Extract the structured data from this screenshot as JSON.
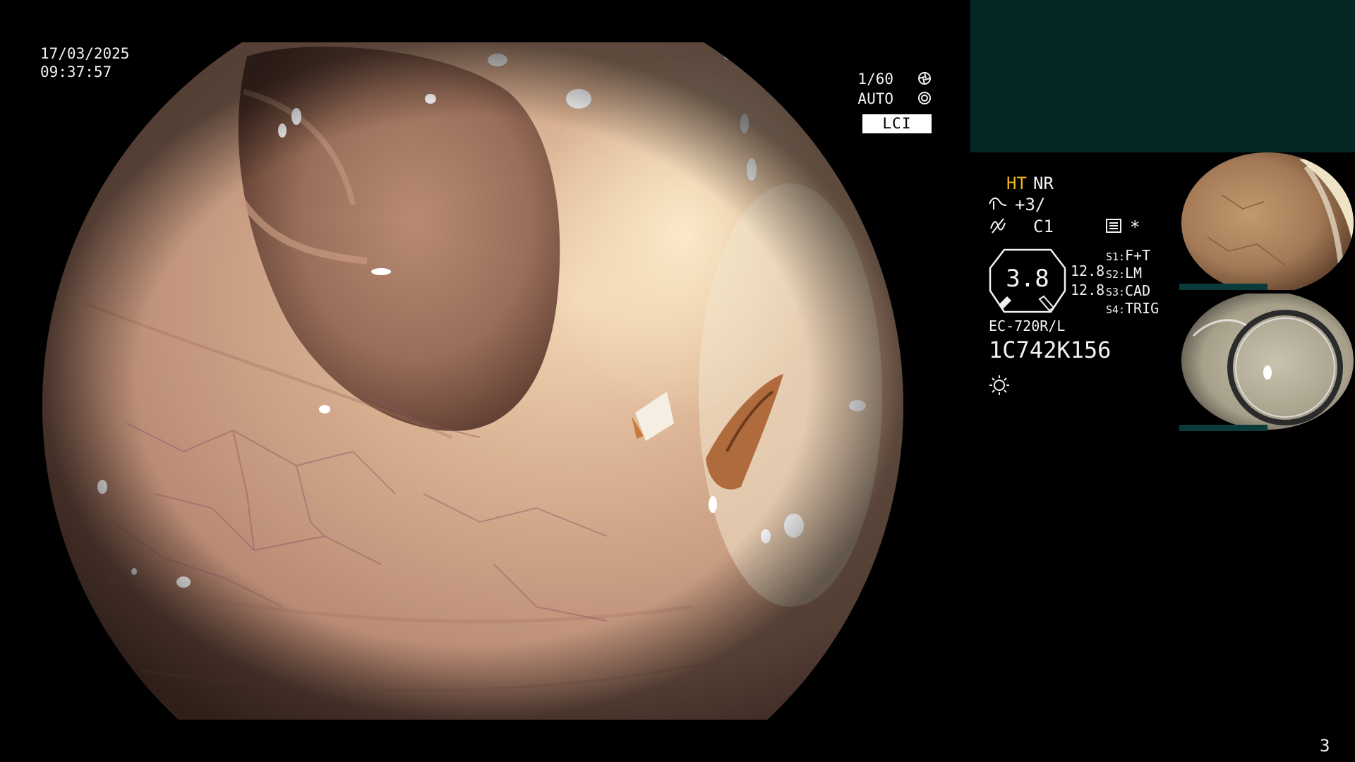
{
  "overlay": {
    "date": "17/03/2025",
    "time": "09:37:57",
    "shutter_speed": "1/60",
    "iris_mode": "AUTO",
    "imaging_mode": "LCI"
  },
  "settings": {
    "ht_label": "HT",
    "nr_label": "NR",
    "enhancement_value": "+3/",
    "color_value": "C1",
    "asterisk": "*",
    "gauge_value": "3.8",
    "magnification": [
      "12.8",
      "12.8"
    ],
    "switches": [
      {
        "key": "S1:",
        "value": "F+T"
      },
      {
        "key": "S2:",
        "value": "LM"
      },
      {
        "key": "S3:",
        "value": "CAD"
      },
      {
        "key": "S4:",
        "value": "TRIG"
      }
    ],
    "scope_model": "EC-720R/L",
    "scope_serial": "1C742K156"
  },
  "icons": [
    "shutter-icon",
    "iris-icon",
    "enhancement-icon",
    "color-icon",
    "record-icon",
    "light-icon"
  ],
  "colors": {
    "ht_accent": "#f1b420",
    "teal_panel": "#062626"
  },
  "page_number": "3"
}
